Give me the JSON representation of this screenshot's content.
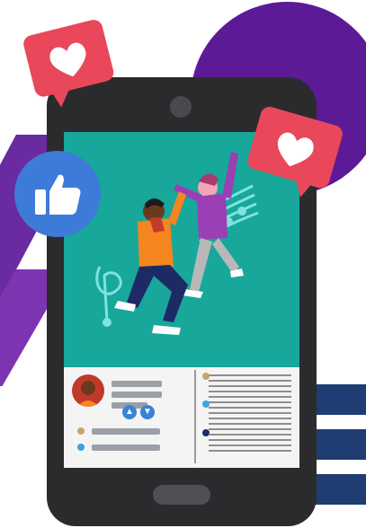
{
  "colors": {
    "screen_bg": "#18a79b",
    "phone_body": "#2b2b2e",
    "heart_bubble": "#e8485a",
    "like_badge": "#3d7bd9",
    "accent_purple": "#5d1a96",
    "accent_navy": "#1f3c73"
  },
  "icons": {
    "like": "thumbs-up-icon",
    "heart": "heart-icon",
    "music": "music-notes-icon",
    "reactions": [
      "thumbs-up-icon",
      "thumbs-down-icon"
    ]
  }
}
